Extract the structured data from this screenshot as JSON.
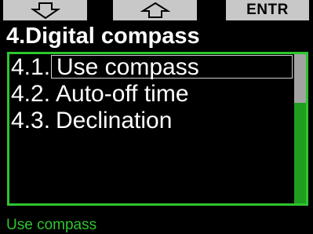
{
  "softkeys": {
    "down_icon": "outline-arrow-down-icon",
    "up_icon": "outline-arrow-up-icon",
    "enter_label": "ENTR"
  },
  "title": "4.Digital compass",
  "menu": {
    "items": [
      {
        "number": "4.1.",
        "label": "Use compass",
        "selected": true
      },
      {
        "number": "4.2.",
        "label": "Auto-off time",
        "selected": false
      },
      {
        "number": "4.3.",
        "label": "Declination",
        "selected": false
      }
    ]
  },
  "status_text": "Use compass",
  "colors": {
    "accent_green": "#2ec52e",
    "softkey_gray": "#c8c8c8",
    "scrollbar_green": "#1f9d1f",
    "scroll_thumb": "#a3a3a3"
  }
}
